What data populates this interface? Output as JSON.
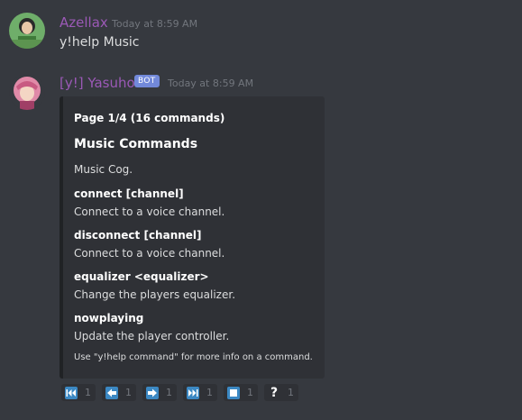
{
  "messages": [
    {
      "author": "Azellax",
      "author_color": "#9b59b6",
      "timestamp": "Today at 8:59 AM",
      "text": "y!help Music"
    },
    {
      "author": "[y!] Yasuho",
      "author_color": "#9b59b6",
      "bot_tag": "BOT",
      "timestamp": "Today at 8:59 AM",
      "embed": {
        "author": "Page 1/4 (16 commands)",
        "title": "Music Commands",
        "description": "Music Cog.",
        "fields": [
          {
            "name": "connect [channel]",
            "value": "Connect to a voice channel."
          },
          {
            "name": "disconnect [channel]",
            "value": "Connect to a voice channel."
          },
          {
            "name": "equalizer <equalizer>",
            "value": "Change the players equalizer."
          },
          {
            "name": "nowplaying",
            "value": "Update the player controller."
          }
        ],
        "footer": "Use \"y!help command\" for more info on a command."
      },
      "reactions": [
        {
          "icon": "first-page-icon",
          "count": "1"
        },
        {
          "icon": "previous-page-icon",
          "count": "1"
        },
        {
          "icon": "next-page-icon",
          "count": "1"
        },
        {
          "icon": "last-page-icon",
          "count": "1"
        },
        {
          "icon": "stop-icon",
          "count": "1"
        },
        {
          "icon": "question-icon",
          "glyph": "?",
          "count": "1"
        }
      ]
    }
  ],
  "colors": {
    "background": "#36393f",
    "embed_background": "#2f3136",
    "bot_tag": "#7289da",
    "reaction_emoji": "#3b88c3"
  }
}
